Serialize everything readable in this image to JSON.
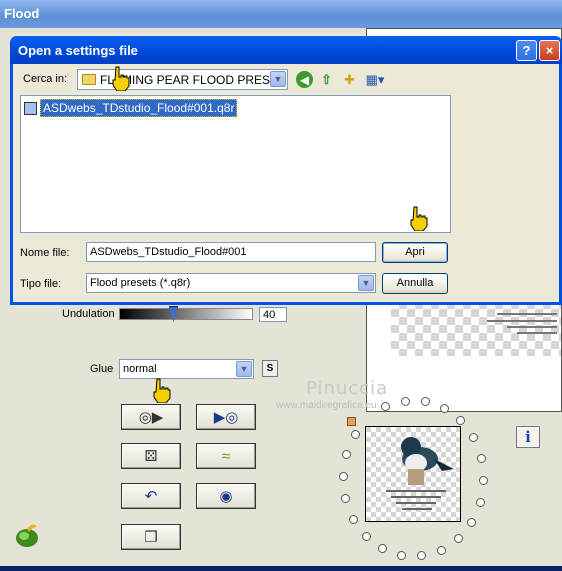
{
  "flood_window": {
    "title": "Flood",
    "undulation": {
      "label": "Undulation",
      "value": "40",
      "level": 0.39
    },
    "glue": {
      "label": "Glue",
      "selected": "normal",
      "s_button": "S"
    },
    "watermark": {
      "line1": "Pinuccia",
      "line2": "www.maidiregrafica.eu"
    },
    "info_button": "i"
  },
  "dialog": {
    "title": "Open a settings file",
    "help": "?",
    "close": "×",
    "look_in": {
      "label": "Cerca in:",
      "value": "FLAMING PEAR FLOOD PRESET"
    },
    "files": [
      {
        "name": "ASDwebs_TDstudio_Flood#001.q8r",
        "selected": true
      }
    ],
    "file_name": {
      "label": "Nome file:",
      "value": "ASDwebs_TDstudio_Flood#001"
    },
    "file_type": {
      "label": "Tipo file:",
      "value": "Flood presets (*.q8r)"
    },
    "open_button": "Apri",
    "cancel_button": "Annulla"
  },
  "colors": {
    "titlebar": "#0054e3",
    "selection": "#316ac5",
    "dialog_bg": "#ece9d8"
  }
}
